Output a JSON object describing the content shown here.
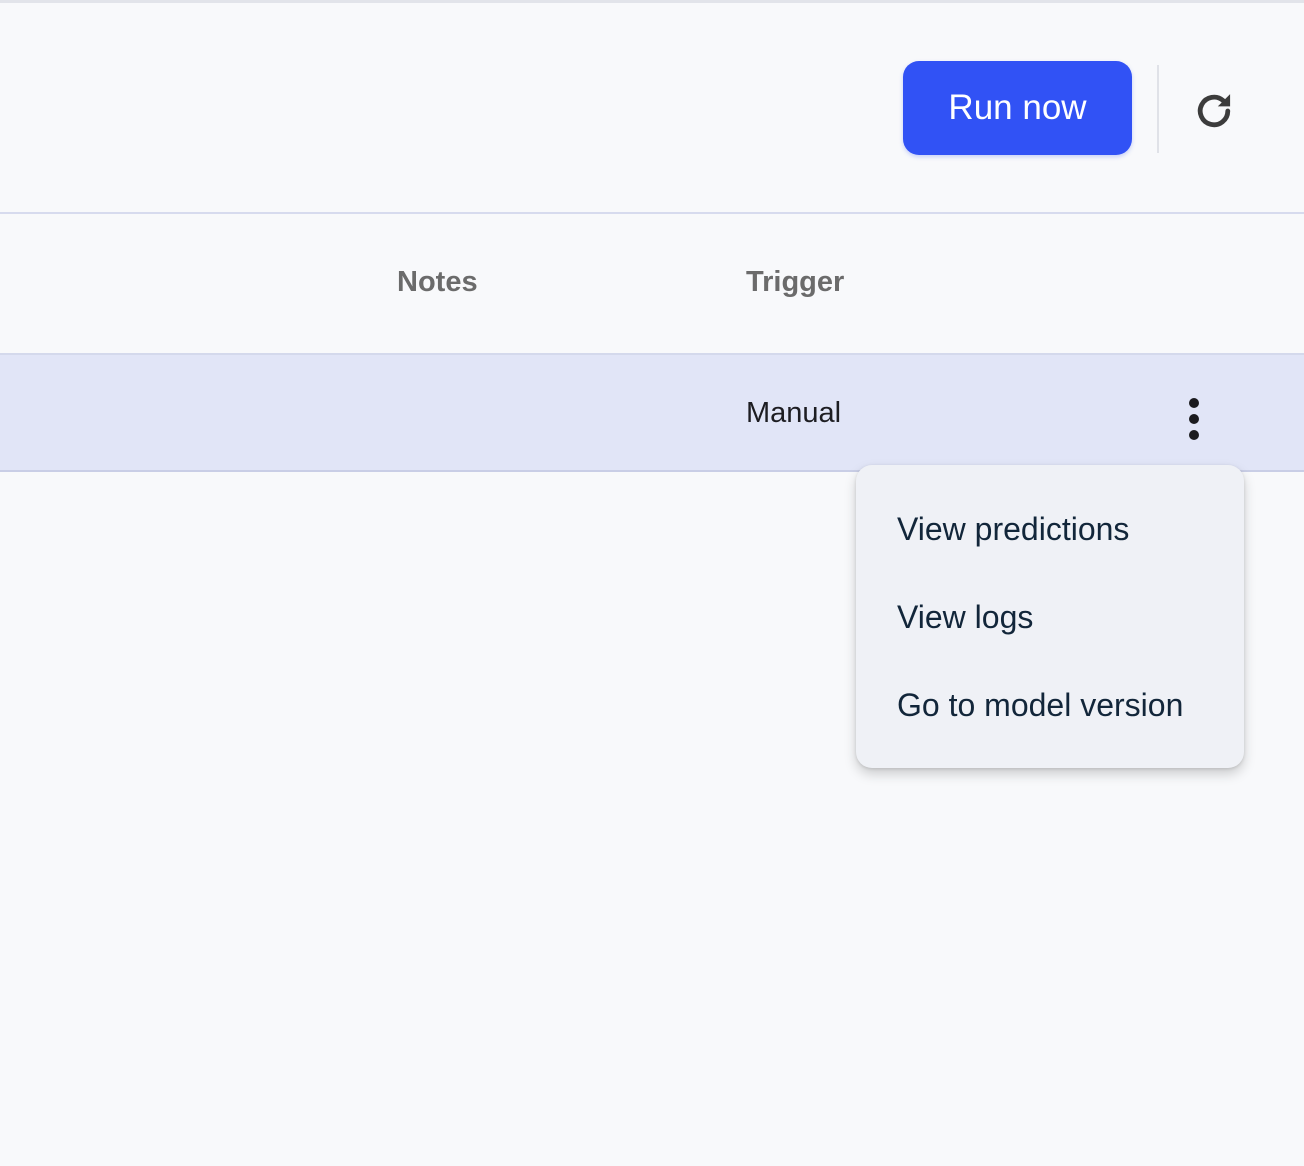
{
  "toolbar": {
    "run_now_label": "Run now",
    "refresh_icon": "refresh-icon",
    "accent_color": "#3152f5"
  },
  "table": {
    "columns": [
      "Notes",
      "Trigger"
    ],
    "rows": [
      {
        "notes": "",
        "trigger": "Manual",
        "actions_icon": "more-vertical-icon",
        "selected": true
      }
    ]
  },
  "context_menu": {
    "items": [
      {
        "label": "View predictions"
      },
      {
        "label": "View logs"
      },
      {
        "label": "Go to model version"
      }
    ]
  }
}
